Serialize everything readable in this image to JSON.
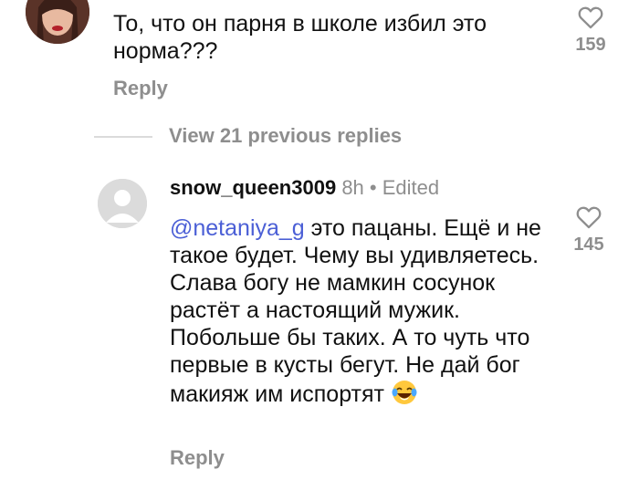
{
  "comment1": {
    "text": "То, что он парня  в школе избил  это норма???",
    "reply_label": "Reply",
    "like_count": "159"
  },
  "view_replies_label": "View 21 previous replies",
  "comment2": {
    "username": "snow_queen3009",
    "time": "8h",
    "separator": "•",
    "edited": "Edited",
    "mention": "@netaniya_g",
    "text": " это пацаны. Ещё и не такое будет. Чему вы удивляетесь. Слава богу не мамкин сосунок растёт а настоящий мужик. Побольше бы таких. А то чуть что первые в кусты бегут. Не дай бог макияж им испортят ",
    "emoji": "laughing-tears-emoji",
    "reply_label": "Reply",
    "like_count": "145"
  },
  "colors": {
    "secondary_text": "#8e8e8e",
    "mention": "#4b5fd6",
    "divider": "#dbdbdb"
  }
}
